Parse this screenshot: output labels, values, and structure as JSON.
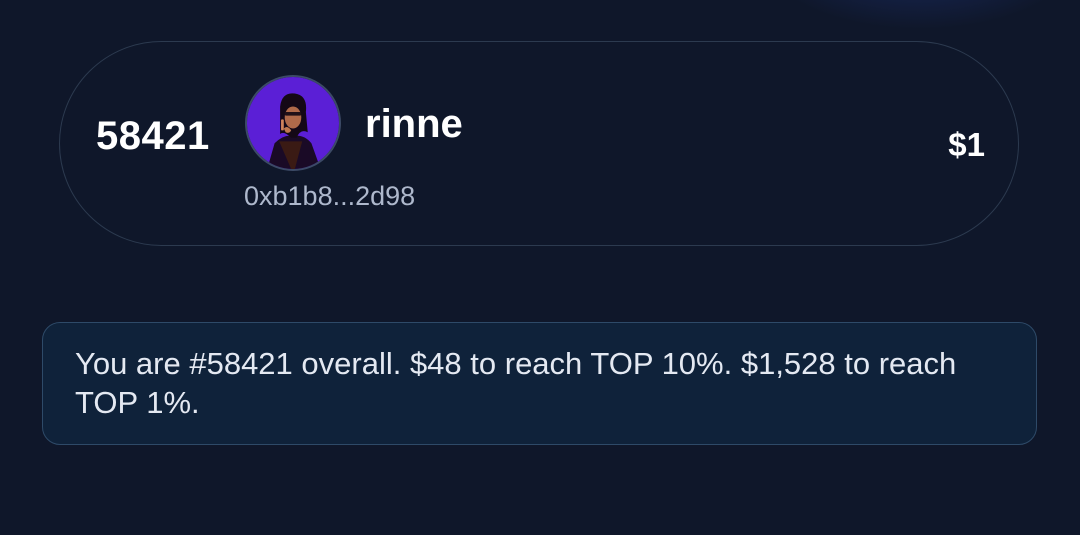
{
  "rank_card": {
    "rank": "58421",
    "username": "rinne",
    "wallet_address": "0xb1b8...2d98",
    "amount": "$1",
    "avatar_icon": "user-avatar-icon"
  },
  "info": {
    "message": "You are #58421 overall. $48 to reach TOP 10%. $1,528 to reach TOP 1%."
  },
  "colors": {
    "background": "#0f172a",
    "card_border": "#2c3a4f",
    "info_background": "#0f223a",
    "info_border": "#2e4a68",
    "avatar_bg": "#5b1fd6"
  }
}
